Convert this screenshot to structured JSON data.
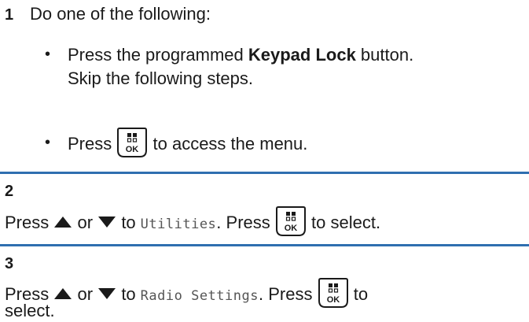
{
  "step1": {
    "number": "1",
    "intro": "Do one of the following:",
    "bullet": "•",
    "option1": {
      "before": "Press the programmed ",
      "bold": "Keypad Lock",
      "after": " button.",
      "line2": "Skip the following steps."
    },
    "option2": {
      "before": "Press",
      "after": "to access the menu."
    }
  },
  "step2": {
    "number": "2",
    "press": "Press",
    "or": "or",
    "to": "to",
    "menu_item": "Utilities",
    "press2": "Press",
    "after": "to select."
  },
  "step3": {
    "number": "3",
    "press": "Press",
    "or": "or",
    "to": "to",
    "menu_item": "Radio Settings",
    "press2": "Press",
    "after": "to",
    "line2": "select."
  },
  "icons": {
    "ok_key_label": "OK",
    "ok_key": "menu-ok-key-icon",
    "up": "up-arrow-icon",
    "down": "down-arrow-icon"
  },
  "colors": {
    "divider": "#2f6fb0",
    "text": "#1a1a1a",
    "menu_text": "#555555"
  }
}
